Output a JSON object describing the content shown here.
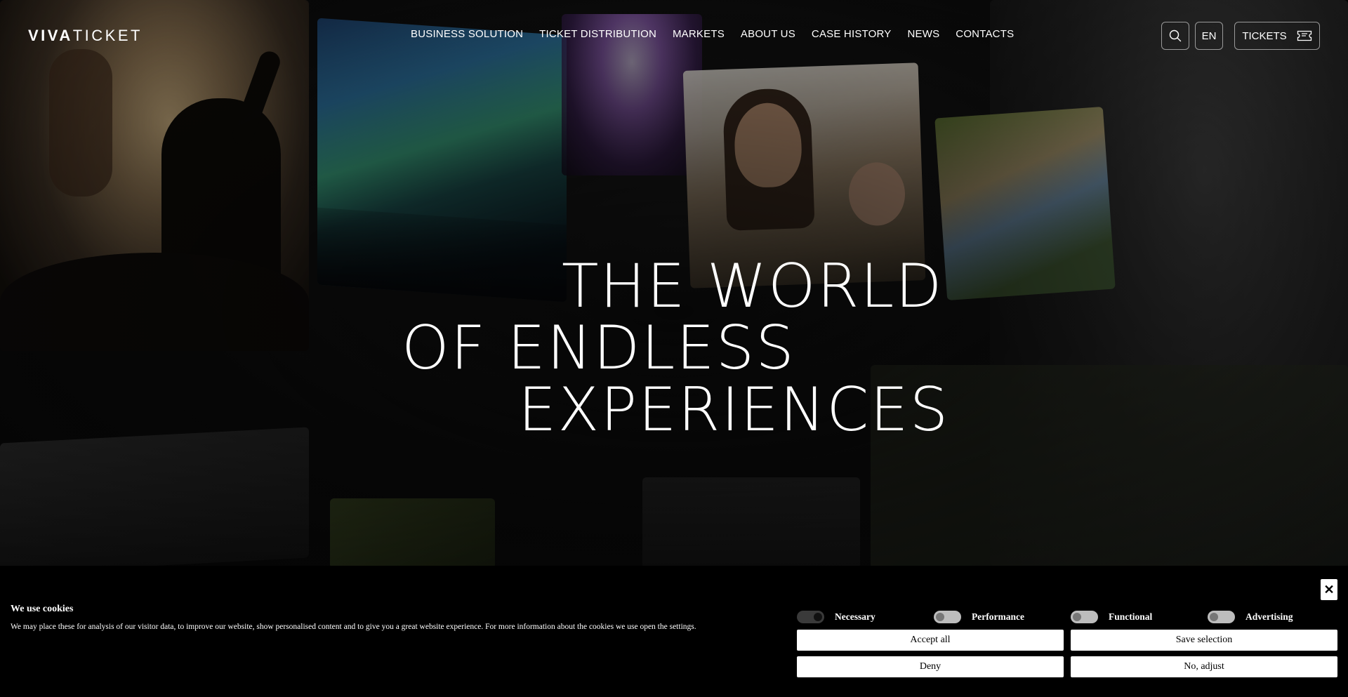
{
  "header": {
    "logo": {
      "part1": "VIVA",
      "part2": "TICKET"
    },
    "nav": [
      {
        "label": "BUSINESS SOLUTION"
      },
      {
        "label": "TICKET DISTRIBUTION"
      },
      {
        "label": "MARKETS"
      },
      {
        "label": "ABOUT US"
      },
      {
        "label": "CASE HISTORY"
      },
      {
        "label": "NEWS"
      },
      {
        "label": "CONTACTS"
      }
    ],
    "search_icon": "search-icon",
    "language": "EN",
    "tickets_label": "TICKETS",
    "tickets_icon": "ticket-icon"
  },
  "hero": {
    "line1": "THE WORLD",
    "line2": "OF ENDLESS",
    "line3": "EXPERIENCES"
  },
  "cookie_banner": {
    "title": "We use cookies",
    "text": "We may place these for analysis of our visitor data, to improve our website, show personalised content and to give you a great website experience. For more information about the cookies we use open the settings.",
    "close_icon": "close-icon",
    "toggles": [
      {
        "label": "Necessary",
        "enabled": true
      },
      {
        "label": "Performance",
        "enabled": false
      },
      {
        "label": "Functional",
        "enabled": false
      },
      {
        "label": "Advertising",
        "enabled": false
      }
    ],
    "buttons": {
      "accept_all": "Accept all",
      "save_selection": "Save selection",
      "deny": "Deny",
      "no_adjust": "No, adjust"
    }
  },
  "colors": {
    "background": "#050505",
    "text": "#ffffff",
    "banner_bg": "#000000",
    "button_bg": "#ffffff"
  }
}
